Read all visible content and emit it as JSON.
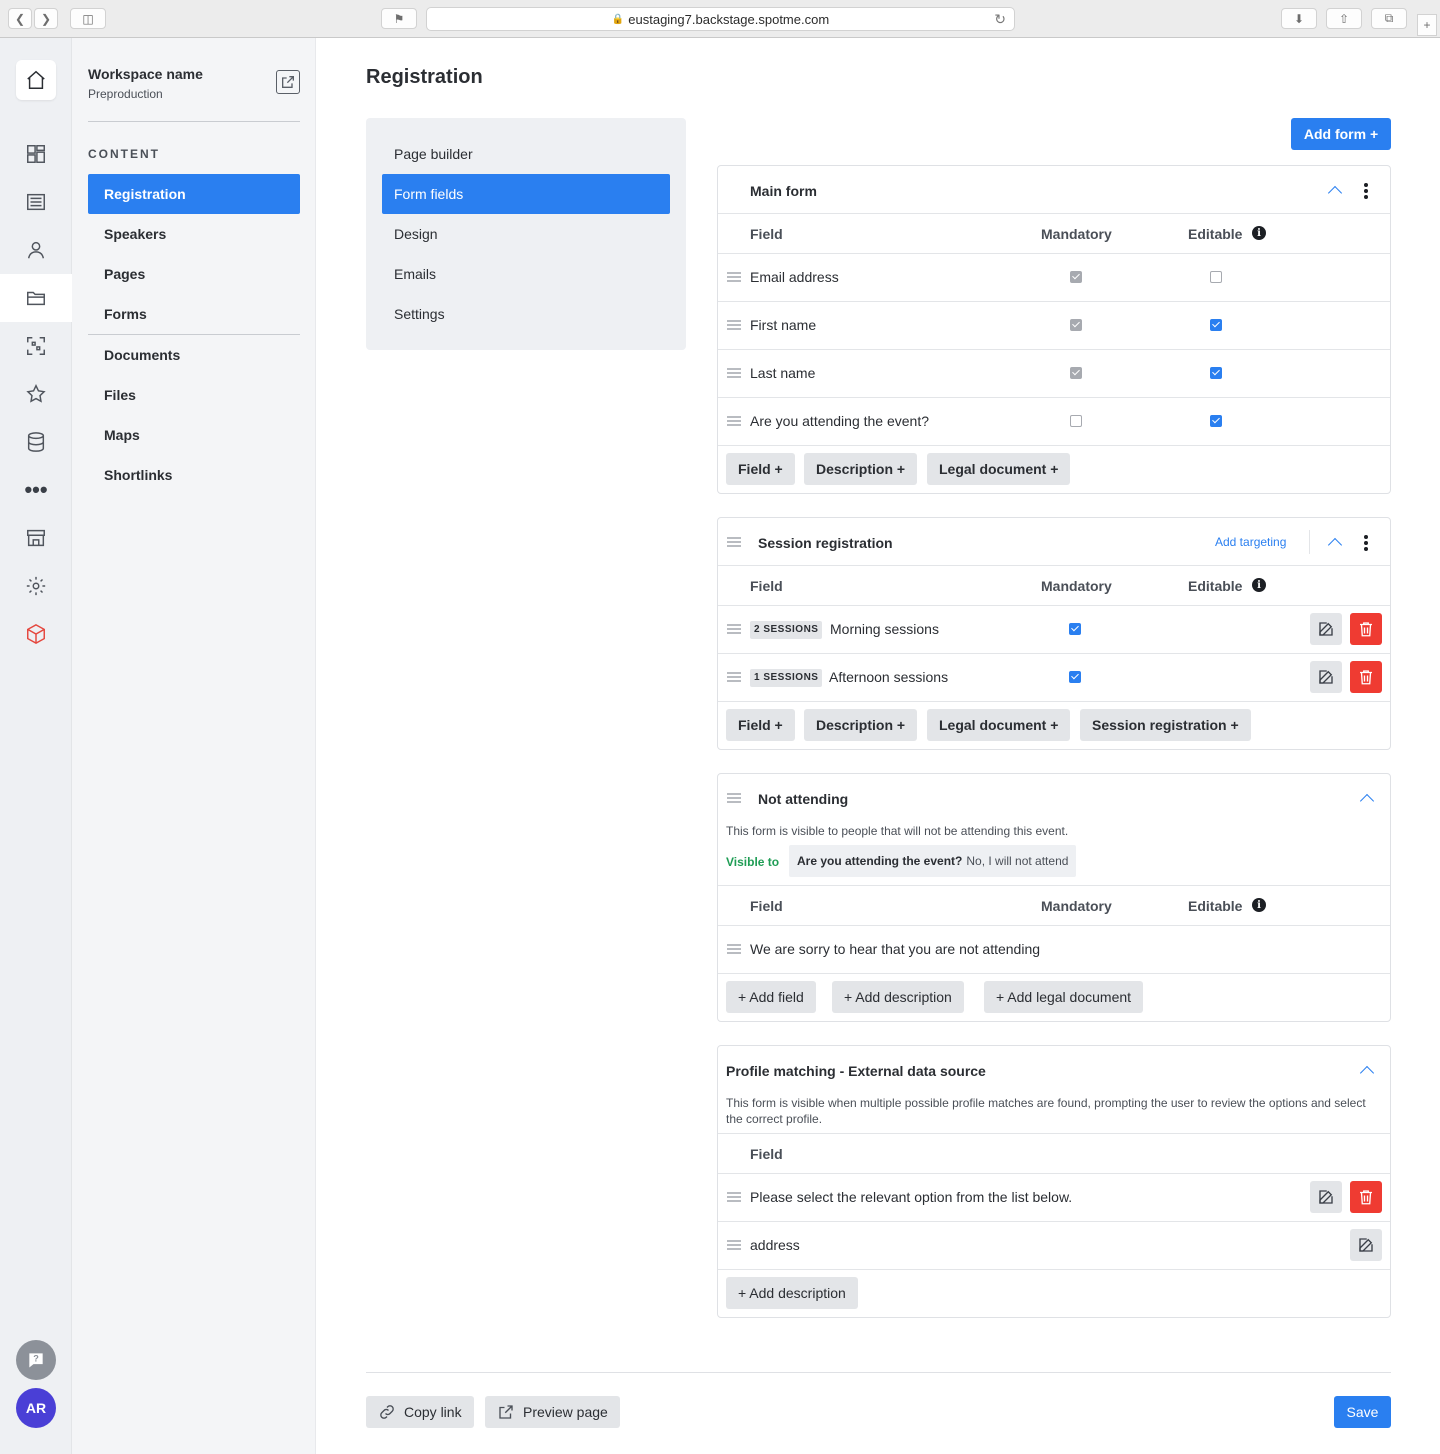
{
  "browser": {
    "url": "eustaging7.backstage.spotme.com"
  },
  "workspace": {
    "name": "Workspace name",
    "env": "Preproduction"
  },
  "sidebar": {
    "section": "CONTENT",
    "items": [
      "Registration",
      "Speakers",
      "Pages",
      "Forms",
      "Documents",
      "Files",
      "Maps",
      "Shortlinks"
    ],
    "active": "Registration"
  },
  "user": {
    "initials": "AR"
  },
  "page": {
    "title": "Registration"
  },
  "subnav": {
    "items": [
      "Page builder",
      "Form fields",
      "Design",
      "Emails",
      "Settings"
    ],
    "active": "Form fields"
  },
  "actions": {
    "add_form": "Add form +",
    "copy_link": "Copy link",
    "preview": "Preview page",
    "save": "Save"
  },
  "columns": {
    "field": "Field",
    "mandatory": "Mandatory",
    "editable": "Editable"
  },
  "main_form": {
    "title": "Main form",
    "rows": [
      {
        "label": "Email address",
        "mandatory": "checked-disabled",
        "editable": "unchecked"
      },
      {
        "label": "First name",
        "mandatory": "checked-disabled",
        "editable": "checked"
      },
      {
        "label": "Last name",
        "mandatory": "checked-disabled",
        "editable": "checked"
      },
      {
        "label": "Are you attending the event?",
        "mandatory": "unchecked",
        "editable": "checked"
      }
    ],
    "buttons": [
      "Field +",
      "Description +",
      "Legal document +"
    ]
  },
  "session_form": {
    "title": "Session registration",
    "add_targeting": "Add targeting",
    "rows": [
      {
        "tag": "2 SESSIONS",
        "label": "Morning sessions",
        "mandatory": "checked"
      },
      {
        "tag": "1 SESSIONS",
        "label": "Afternoon sessions",
        "mandatory": "checked"
      }
    ],
    "buttons": [
      "Field +",
      "Description +",
      "Legal document +",
      "Session registration +"
    ]
  },
  "not_attending": {
    "title": "Not attending",
    "description": "This form is visible to people that will not be attending this event.",
    "visible_to_label": "Visible to",
    "condition_question": "Are you attending the event?",
    "condition_answer": "No, I will not attend",
    "rows": [
      {
        "label": "We are sorry to hear that you are not attending"
      }
    ],
    "buttons": [
      "+ Add field",
      "+ Add description",
      "+ Add legal document"
    ]
  },
  "profile_matching": {
    "title": "Profile matching - External data source",
    "description": "This form is visible when multiple possible profile matches are found, prompting the user to review the options and select the correct profile.",
    "rows": [
      {
        "label": "Please select the relevant option from the list below."
      },
      {
        "label": "address"
      }
    ],
    "buttons": [
      "+ Add description"
    ]
  },
  "colors": {
    "accent": "#2a7ff0",
    "danger": "#ef3b32",
    "visible_to": "#1f9d55"
  }
}
